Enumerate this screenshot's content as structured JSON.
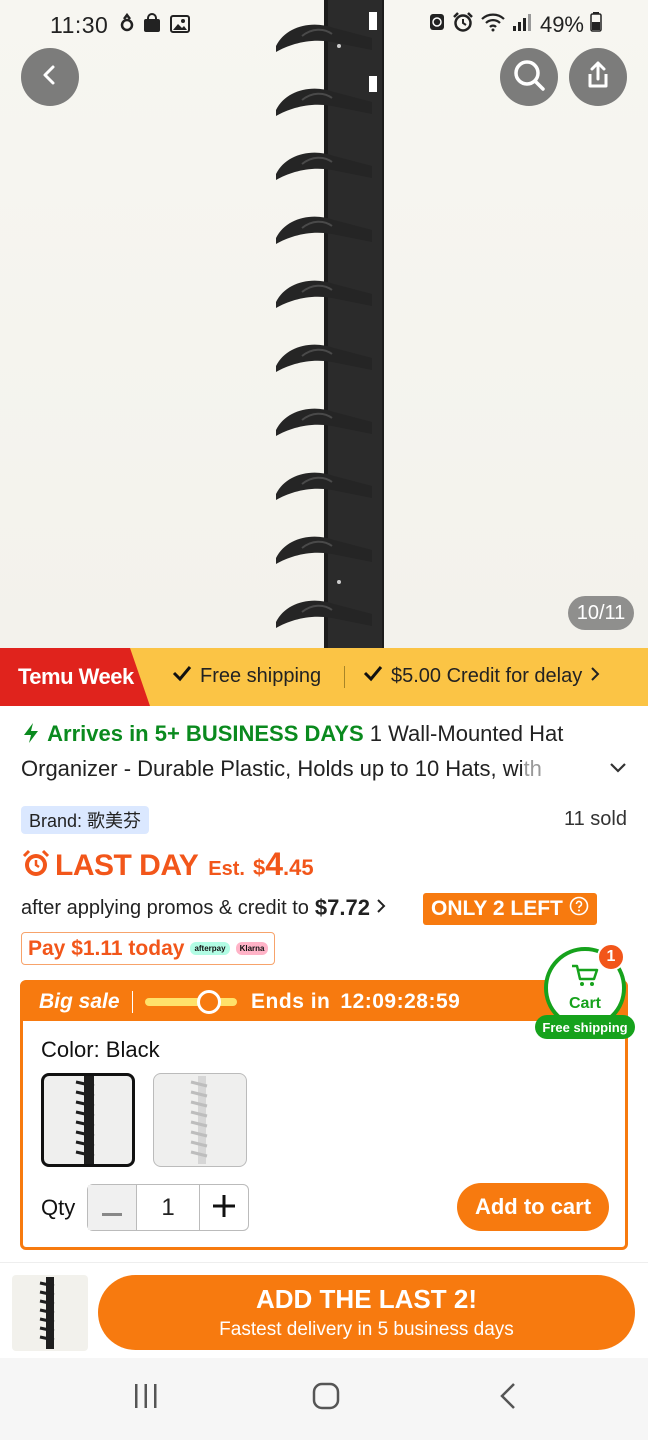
{
  "status_bar": {
    "time": "11:30",
    "battery": "49%",
    "icons": [
      "notification-icon",
      "shopping-bag-icon",
      "image-icon",
      "recycle-icon",
      "alarm-icon",
      "wifi-icon",
      "signal-icon",
      "battery-icon"
    ]
  },
  "hero": {
    "image_counter": "10/11",
    "icons": {
      "back": "back-arrow-icon",
      "search": "search-icon",
      "share": "share-icon"
    }
  },
  "promo_banner": {
    "tag": "Temu Week",
    "free_shipping": "Free shipping",
    "credit": "$5.00 Credit for delay"
  },
  "product": {
    "arrives": "Arrives in 5+ BUSINESS DAYS",
    "title_main": "1 Wall-Mounted Hat Organizer - Durable Plastic, Holds up to 10 Hats, wi",
    "title_faded": "th",
    "brand": "Brand: 歌美芬",
    "sold": "11 sold",
    "last_day": "LAST DAY",
    "est": "Est.",
    "price_symbol": "$",
    "price_int": "4",
    "price_dec": ".45",
    "after_promos": "after applying promos & credit to",
    "after_price": "$7.72",
    "only_left": "ONLY 2 LEFT",
    "pay_today": "Pay $1.11 today",
    "pay_logos": [
      "afterpay",
      "Klarna"
    ]
  },
  "cart_fab": {
    "label": "Cart",
    "count": "1",
    "free_shipping": "Free shipping"
  },
  "sale_panel": {
    "big_sale": "Big sale",
    "ends_label": "Ends in",
    "countdown": "12:09:28:59",
    "countdown_progress": 0.7,
    "color_label": "Color: Black",
    "qty_label": "Qty",
    "qty_value": "1",
    "add_to_cart": "Add to cart"
  },
  "bottom_bar": {
    "cta_main": "ADD THE LAST 2!",
    "cta_sub": "Fastest delivery in 5 business days"
  },
  "colors": {
    "accent_orange": "#f77a0f",
    "price_red": "#f2561a",
    "green": "#16a21c",
    "banner_yellow": "#fbc445",
    "tag_red": "#e0231d"
  }
}
